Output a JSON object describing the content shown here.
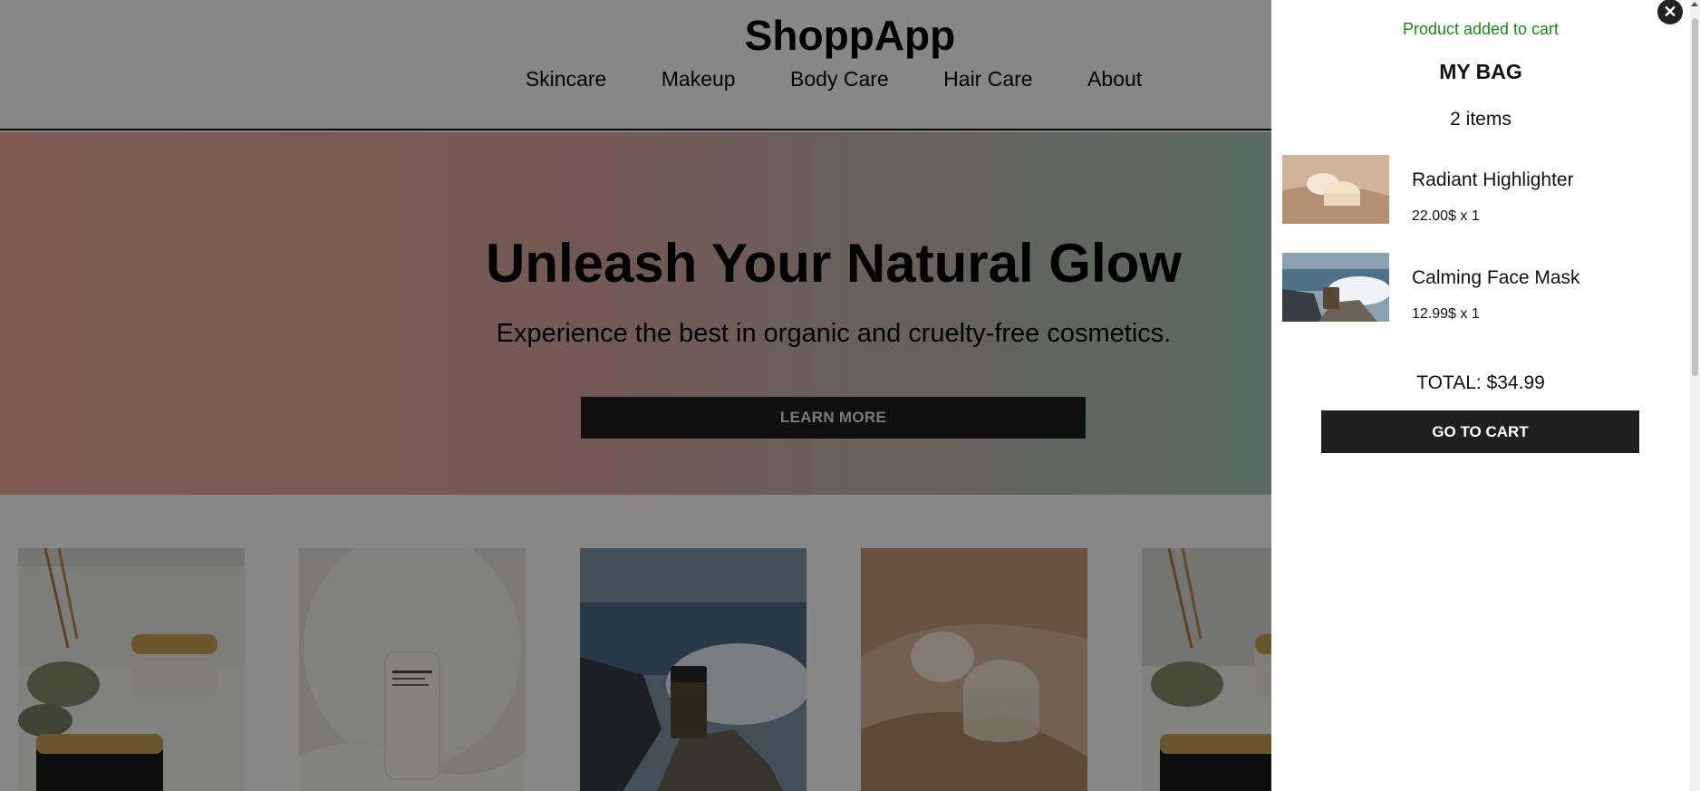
{
  "app": {
    "name": "ShoppApp"
  },
  "nav": {
    "items": [
      "Skincare",
      "Makeup",
      "Body Care",
      "Hair Care",
      "About"
    ]
  },
  "hero": {
    "title": "Unleash Your Natural Glow",
    "subtitle": "Experience the best in organic and cruelty-free cosmetics.",
    "button_label": "LEARN MORE"
  },
  "products": {
    "thumbnails": [
      "cream-jar-eucalyptus-photo",
      "lotion-tube-photo",
      "jar-on-rocks-waves-photo",
      "open-cream-jars-photo",
      "cream-jar-eucalyptus-photo"
    ]
  },
  "cart": {
    "close_label": "✕",
    "toast": "Product added to cart",
    "title": "MY BAG",
    "count": "2 items",
    "items": [
      {
        "name": "Radiant Highlighter",
        "price": "22.00$ x 1"
      },
      {
        "name": "Calming Face Mask",
        "price": "12.99$ x 1"
      }
    ],
    "total": "TOTAL: $34.99",
    "button_label": "GO TO CART"
  },
  "colors": {
    "toast": "#1a8a1a",
    "button_dark": "#1f1f1f",
    "overlay": "rgba(0,0,0,0.47)"
  }
}
